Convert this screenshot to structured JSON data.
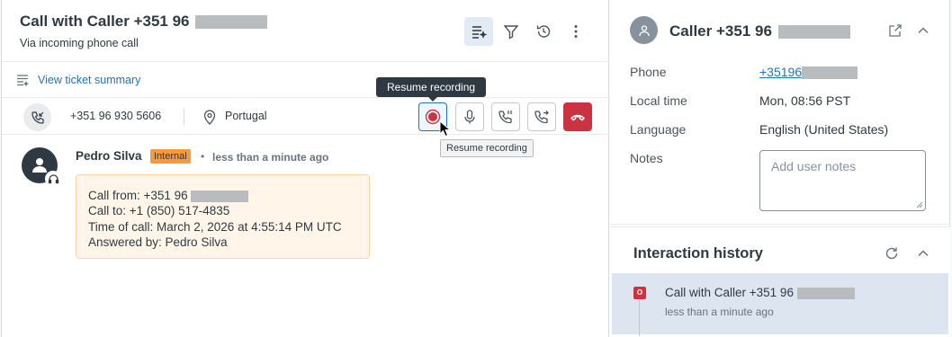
{
  "ticket": {
    "title": "Call with Caller +351 96",
    "subtitle": "Via incoming phone call",
    "view_summary": "View ticket summary"
  },
  "callbar": {
    "number": "+351 96 930 5606",
    "country": "Portugal",
    "tooltip_dark": "Resume recording",
    "tooltip_light": "Resume recording"
  },
  "event": {
    "author": "Pedro Silva",
    "badge": "Internal",
    "separator": "•",
    "time": "less than a minute ago",
    "note_lines": [
      "Call from: +351 96",
      "Call to: +1 (850) 517-4835",
      "Time of call: March 2, 2026 at 4:55:14 PM UTC",
      "Answered by: Pedro Silva"
    ]
  },
  "caller": {
    "name": "Caller +351 96",
    "fields": [
      {
        "label": "Phone",
        "value": "+35196"
      },
      {
        "label": "Local time",
        "value": "Mon, 08:56 PST"
      },
      {
        "label": "Language",
        "value": "English (United States)"
      },
      {
        "label": "Notes",
        "placeholder": "Add user notes"
      }
    ]
  },
  "history": {
    "title": "Interaction history",
    "items": [
      {
        "badge": "O",
        "title": "Call with Caller +351 96",
        "time": "less than a minute ago"
      }
    ]
  },
  "colors": {
    "link": "#1f73b7",
    "hangup": "#cc3340",
    "internal_badge": "#f79a3e",
    "note_bg": "#fff6e9",
    "history_selected": "#dde6f0"
  }
}
